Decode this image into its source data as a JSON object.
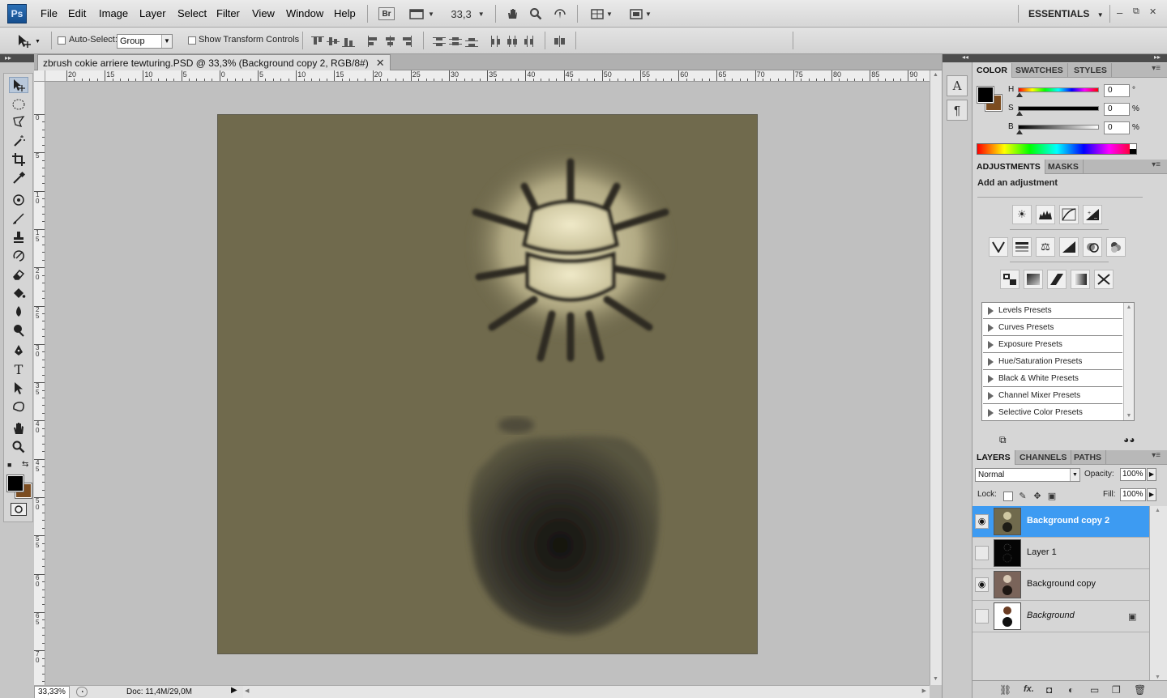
{
  "app": {
    "logo": "Ps",
    "workspace": "ESSENTIALS"
  },
  "menu": [
    "File",
    "Edit",
    "Image",
    "Layer",
    "Select",
    "Filter",
    "View",
    "Window",
    "Help"
  ],
  "menubar": {
    "bridge_label": "Br",
    "zoom_value": "33,3"
  },
  "window_controls": {
    "minimize": "–",
    "restore": "⧉",
    "close": "✕"
  },
  "options": {
    "auto_select_label": "Auto-Select:",
    "auto_select_value": "Group",
    "show_transform_label": "Show Transform Controls"
  },
  "document": {
    "tab_title": "zbrush cokie arriere tewturing.PSD @ 33,3% (Background copy 2, RGB/8#)",
    "close": "✕"
  },
  "rulers": {
    "h_labels": [
      "20",
      "15",
      "10",
      "5",
      "0",
      "5",
      "10",
      "15",
      "20",
      "25",
      "30",
      "35",
      "40",
      "45",
      "50",
      "55",
      "60",
      "65",
      "70",
      "75",
      "80",
      "85",
      "90"
    ],
    "v_labels": [
      "0",
      "5",
      "10",
      "15",
      "20",
      "25",
      "30",
      "35",
      "40",
      "45",
      "50",
      "55",
      "60",
      "65",
      "70"
    ]
  },
  "status": {
    "zoom": "33,33%",
    "doc": "Doc: 11,4M/29,0M"
  },
  "color_panel": {
    "tabs": [
      "COLOR",
      "SWATCHES",
      "STYLES"
    ],
    "sliders": [
      {
        "label": "H",
        "value": "0",
        "unit": "°"
      },
      {
        "label": "S",
        "value": "0",
        "unit": "%"
      },
      {
        "label": "B",
        "value": "0",
        "unit": "%"
      }
    ],
    "fg": "#000000",
    "bg": "#7c4d21"
  },
  "adjustments_panel": {
    "tabs": [
      "ADJUSTMENTS",
      "MASKS"
    ],
    "title": "Add an adjustment",
    "presets": [
      "Levels Presets",
      "Curves Presets",
      "Exposure Presets",
      "Hue/Saturation Presets",
      "Black & White Presets",
      "Channel Mixer Presets",
      "Selective Color Presets"
    ]
  },
  "layers_panel": {
    "tabs": [
      "LAYERS",
      "CHANNELS",
      "PATHS"
    ],
    "blend_mode": "Normal",
    "opacity_label": "Opacity:",
    "opacity": "100%",
    "lock_label": "Lock:",
    "fill_label": "Fill:",
    "fill": "100%",
    "layers": [
      {
        "name": "Background copy 2",
        "visible": true,
        "selected": true
      },
      {
        "name": "Layer 1",
        "visible": false,
        "selected": false
      },
      {
        "name": "Background copy",
        "visible": true,
        "selected": false
      },
      {
        "name": "Background",
        "visible": false,
        "selected": false,
        "locked": true
      }
    ]
  },
  "icons": {
    "eye": "◉",
    "lock": "🔒"
  }
}
